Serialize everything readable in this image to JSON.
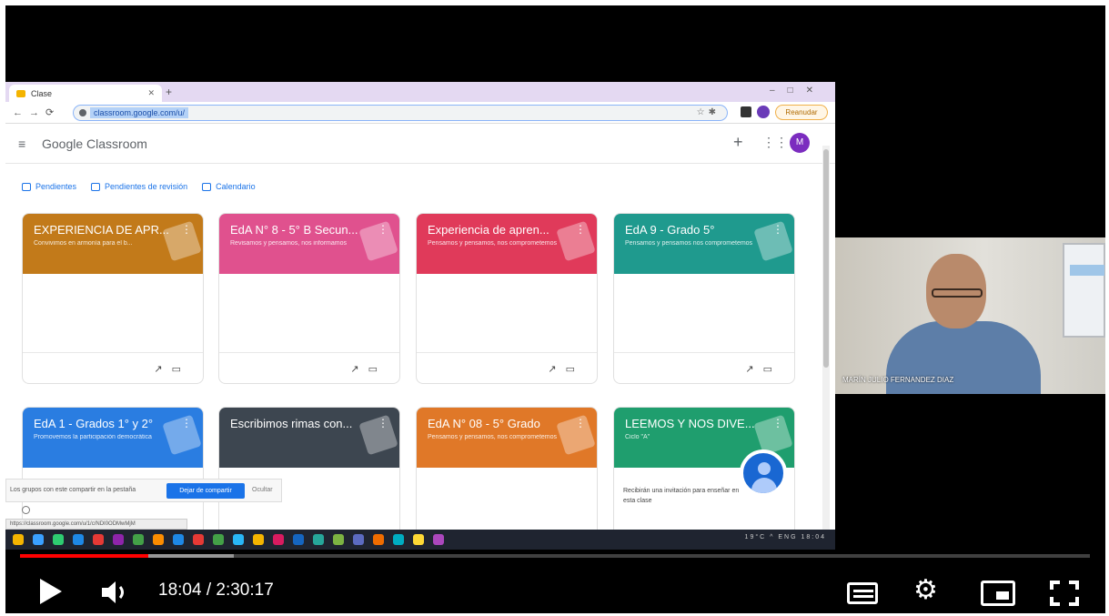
{
  "browser": {
    "tab_title": "Clase",
    "url": "classroom.google.com/u/",
    "reanudar_label": "Reanudar"
  },
  "classroom": {
    "brand": "Google Classroom",
    "avatar_letter": "M",
    "subnav": [
      "Pendientes",
      "Pendientes de revisión",
      "Calendario"
    ],
    "cards": [
      {
        "title": "EXPERIENCIA DE APR...",
        "subtitle": "Convivimos en armonía para el b...",
        "color": "#c27a1a"
      },
      {
        "title": "EdA N° 8 - 5° B Secun...",
        "subtitle": "Revisamos y pensamos, nos informamos",
        "color": "#e0518e"
      },
      {
        "title": "Experiencia de apren...",
        "subtitle": "Pensamos y pensamos, nos comprometemos",
        "color": "#e03a5a"
      },
      {
        "title": "EdA 9 - Grado 5°",
        "subtitle": "Pensamos y pensamos nos comprometemos",
        "color": "#1f9a8e"
      },
      {
        "title": "EdA 1 - Grados 1° y 2°",
        "subtitle": "Promovemos la participación democrática",
        "color": "#2a7de1"
      },
      {
        "title": "Escribimos rimas con...",
        "subtitle": "",
        "color": "#3d4650"
      },
      {
        "title": "EdA N° 08 - 5° Grado",
        "subtitle": "Pensamos y pensamos, nos comprometemos",
        "color": "#e07828"
      },
      {
        "title": "LEEMOS Y NOS DIVE...",
        "subtitle": "Ciclo \"A\"",
        "color": "#1f9e6e",
        "note": "Recibirán una invitación para enseñar en esta clase"
      }
    ],
    "cookie_text": "Los grupos con este compartir en la pestaña",
    "cookie_button": "Dejar de compartir",
    "cookie_hide": "Ocultar",
    "status_url": "https://classroom.google.com/u/1/c/NDI0ODMwMjM"
  },
  "webcam": {
    "name": "MARÍN JULIO FERNANDEZ DIAZ"
  },
  "player": {
    "current_time": "18:04",
    "duration": "2:30:17",
    "time_display": "18:04 / 2:30:17",
    "played_fraction": 0.12,
    "loaded_fraction": 0.2
  },
  "taskbar": {
    "icon_colors": [
      "#f4b400",
      "#3aa0ff",
      "#2ecc71",
      "#1e88e5",
      "#e53935",
      "#8e24aa",
      "#43a047",
      "#fb8c00",
      "#1e88e5",
      "#e53935",
      "#43a047",
      "#29b6f6",
      "#f4b400",
      "#d81b60",
      "#1565c0",
      "#26a69a",
      "#7cb342",
      "#5c6bc0",
      "#ef6c00",
      "#00acc1",
      "#fdd835",
      "#ab47bc"
    ],
    "tray_text": "19°C ^ ENG 18:04"
  }
}
